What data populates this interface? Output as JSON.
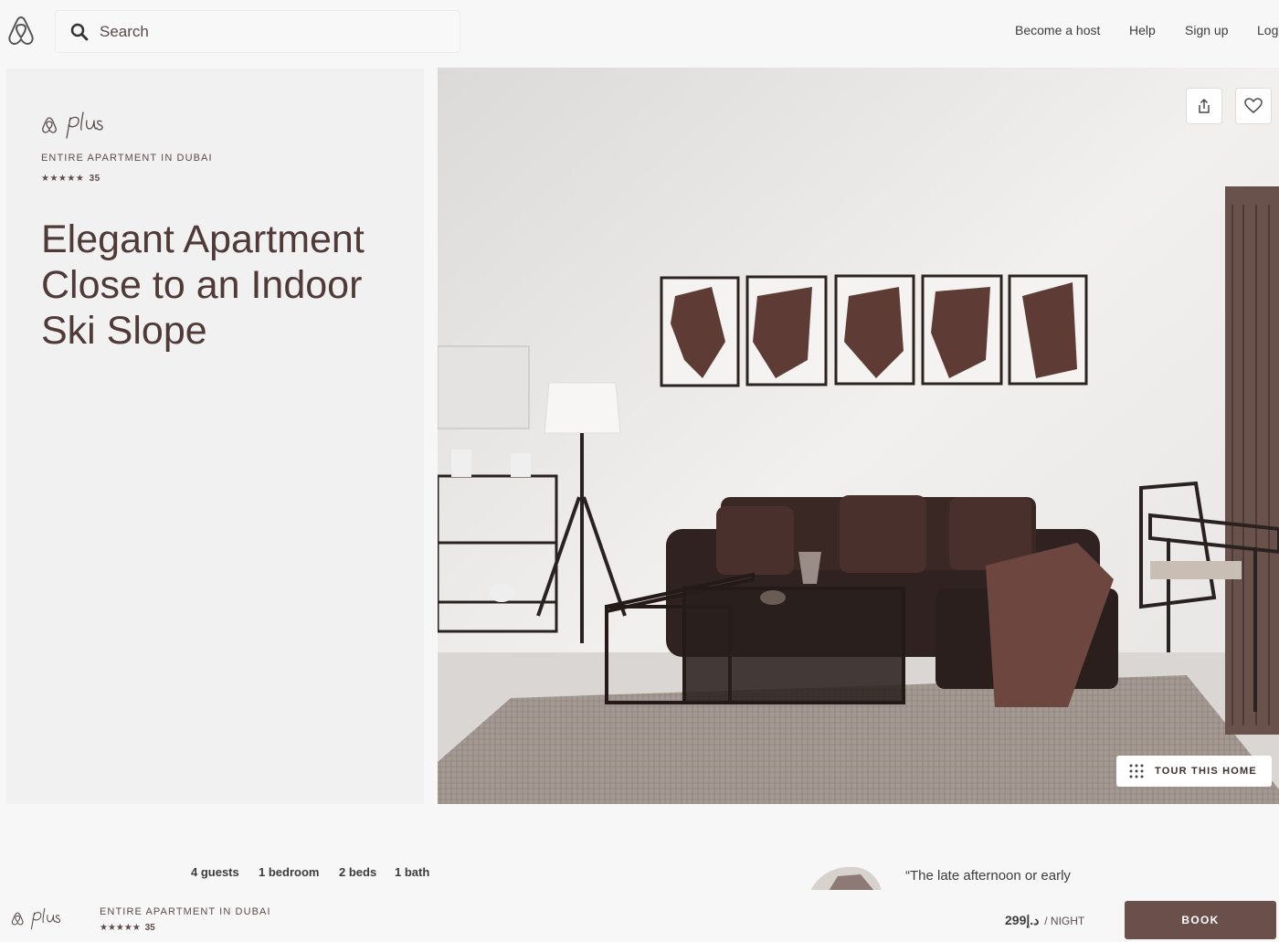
{
  "header": {
    "search_placeholder": "Search",
    "nav": {
      "become_host": "Become a host",
      "help": "Help",
      "sign_up": "Sign up",
      "log_in": "Log in"
    }
  },
  "listing": {
    "kicker": "ENTIRE APARTMENT IN DUBAI",
    "stars": "★★★★★",
    "review_count": "35",
    "title": "Elegant Apartment Close to an Indoor Ski Slope"
  },
  "photo": {
    "tour_label": "TOUR THIS HOME"
  },
  "facts": {
    "guests": "4 guests",
    "bedroom": "1 bedroom",
    "beds": "2 beds",
    "bath": "1 bath"
  },
  "host_quote": "“The late afternoon or early",
  "bottom_bar": {
    "kicker": "ENTIRE APARTMENT IN DUBAI",
    "stars": "★★★★★",
    "review_count": "35",
    "price": "299د.إ",
    "price_unit": "/ NIGHT",
    "book_label": "BOOK"
  },
  "colors": {
    "brand_brown": "#6b4f4b",
    "title_text": "#4f3a38",
    "panel_bg": "#f1f1f1"
  }
}
